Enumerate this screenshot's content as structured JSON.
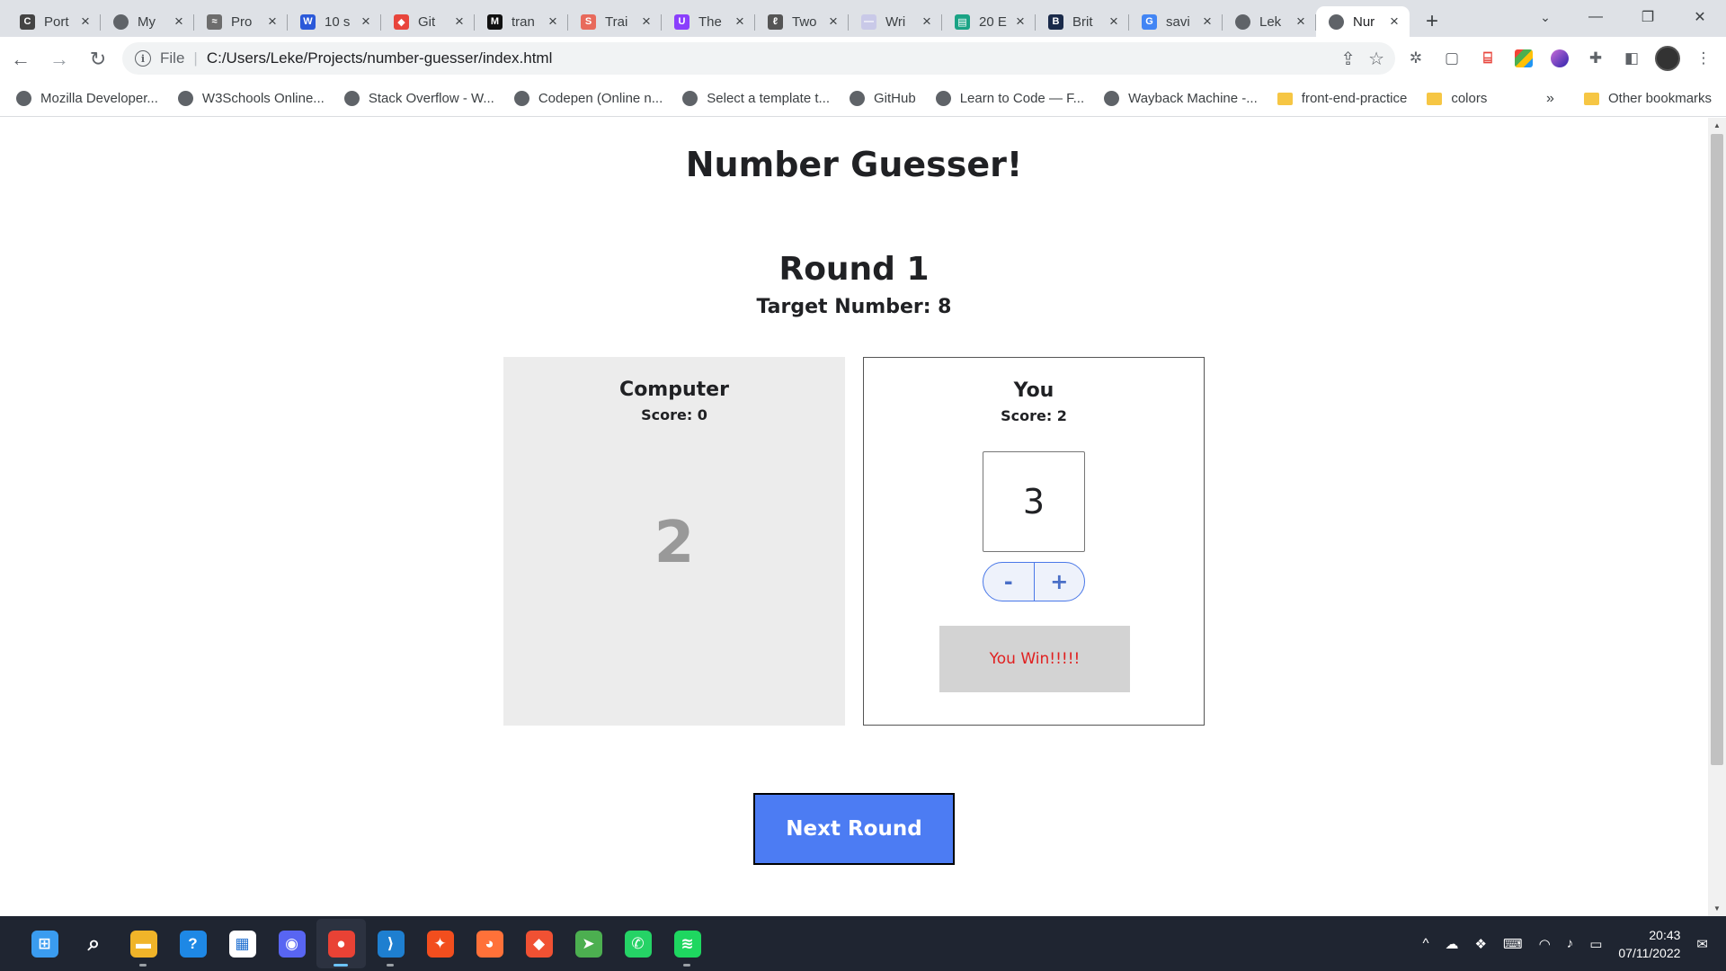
{
  "browser": {
    "tabs": [
      {
        "title": "Port",
        "icon_color": "#444444",
        "icon_glyph": "C"
      },
      {
        "title": "My",
        "icon_color": "#5f6368",
        "icon_glyph": ""
      },
      {
        "title": "Pro",
        "icon_color": "#6d6d6d",
        "icon_glyph": "≈"
      },
      {
        "title": "10 s",
        "icon_color": "#2b59d9",
        "icon_glyph": "W"
      },
      {
        "title": "Git",
        "icon_color": "#e8453c",
        "icon_glyph": "◆"
      },
      {
        "title": "tran",
        "icon_color": "#111111",
        "icon_glyph": "M"
      },
      {
        "title": "Trai",
        "icon_color": "#e86a5c",
        "icon_glyph": "S"
      },
      {
        "title": "The",
        "icon_color": "#8a3ffc",
        "icon_glyph": "U"
      },
      {
        "title": "Two",
        "icon_color": "#555555",
        "icon_glyph": "ℓ"
      },
      {
        "title": "Wri",
        "icon_color": "#c9c9e8",
        "icon_glyph": "—"
      },
      {
        "title": "20 E",
        "icon_color": "#1aa385",
        "icon_glyph": "▤"
      },
      {
        "title": "Brit",
        "icon_color": "#1a2a4a",
        "icon_glyph": "B"
      },
      {
        "title": "savi",
        "icon_color": "#4285f4",
        "icon_glyph": "G"
      },
      {
        "title": "Lek",
        "icon_color": "#5f6368",
        "icon_glyph": ""
      },
      {
        "title": "Nur",
        "icon_color": "#5f6368",
        "icon_glyph": "",
        "active": true
      }
    ],
    "new_tab": "+",
    "tab_search": "⌄",
    "window_controls": {
      "minimize": "—",
      "maximize": "❐",
      "close": "✕"
    },
    "nav": {
      "back": "←",
      "forward": "→",
      "reload": "↻"
    },
    "address": {
      "info_icon": "i",
      "protocol": "File",
      "separator": "|",
      "url": "C:/Users/Leke/Projects/number-guesser/index.html"
    },
    "bookmarks": [
      {
        "label": "Mozilla Developer...",
        "type": "site"
      },
      {
        "label": "W3Schools Online...",
        "type": "site"
      },
      {
        "label": "Stack Overflow - W...",
        "type": "site"
      },
      {
        "label": "Codepen (Online n...",
        "type": "site"
      },
      {
        "label": "Select a template t...",
        "type": "site"
      },
      {
        "label": "GitHub",
        "type": "site"
      },
      {
        "label": "Learn to Code — F...",
        "type": "site"
      },
      {
        "label": "Wayback Machine -...",
        "type": "site"
      },
      {
        "label": "front-end-practice",
        "type": "folder"
      },
      {
        "label": "colors",
        "type": "folder"
      }
    ],
    "bookmarks_more": "»",
    "other_bookmarks": "Other bookmarks"
  },
  "game": {
    "title": "Number Guesser!",
    "round_label": "Round 1",
    "target_label": "Target Number: 8",
    "computer": {
      "name": "Computer",
      "score": "Score: 0",
      "guess": "2"
    },
    "human": {
      "name": "You",
      "score": "Score: 2",
      "guess": "3",
      "decrement": "-",
      "increment": "+",
      "result": "You Win!!!!!"
    },
    "next_round_label": "Next Round"
  },
  "taskbar": {
    "apps": [
      {
        "name": "start",
        "color": "#3a9cf0",
        "glyph": "⊞"
      },
      {
        "name": "search",
        "color": "transparent",
        "glyph": "⌕"
      },
      {
        "name": "file-explorer",
        "color": "#f0b429",
        "glyph": "▬",
        "running": true
      },
      {
        "name": "help",
        "color": "#1e88e5",
        "glyph": "?"
      },
      {
        "name": "store",
        "color": "#ffffff",
        "glyph": "▦"
      },
      {
        "name": "discord",
        "color": "#5865f2",
        "glyph": "◉"
      },
      {
        "name": "chrome",
        "color": "#e94235",
        "glyph": "●",
        "running": true,
        "focused": true
      },
      {
        "name": "vscode",
        "color": "#1e7fd0",
        "glyph": "⟩",
        "running": true
      },
      {
        "name": "figma",
        "color": "#f24e1e",
        "glyph": "✦"
      },
      {
        "name": "firefox",
        "color": "#ff7139",
        "glyph": "◕"
      },
      {
        "name": "git",
        "color": "#f05133",
        "glyph": "◆"
      },
      {
        "name": "telegram",
        "color": "#4caf50",
        "glyph": "➤"
      },
      {
        "name": "whatsapp",
        "color": "#25d366",
        "glyph": "✆"
      },
      {
        "name": "spotify",
        "color": "#1ed760",
        "glyph": "≋",
        "running": true
      }
    ],
    "tray": {
      "chevron": "^",
      "time": "20:43",
      "date": "07/11/2022"
    }
  }
}
